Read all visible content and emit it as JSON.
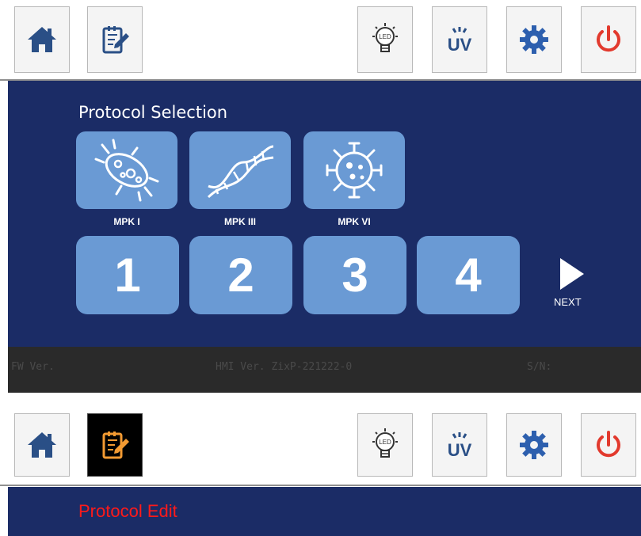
{
  "toolbar": {
    "icons": [
      "home-icon",
      "edit-icon",
      "led-icon",
      "uv-icon",
      "gear-icon",
      "power-icon"
    ],
    "led_label": "LED",
    "uv_label": "UV"
  },
  "screen1": {
    "title": "Protocol Selection",
    "protocols": [
      {
        "label": "MPK I",
        "icon": "bacteria-icon"
      },
      {
        "label": "MPK III",
        "icon": "dna-icon"
      },
      {
        "label": "MPK VI",
        "icon": "virus-icon"
      }
    ],
    "numbers": [
      "1",
      "2",
      "3",
      "4"
    ],
    "next_label": "NEXT",
    "status": {
      "fw": "FW Ver.",
      "hmi": "HMI  Ver. ZixP-221222-0",
      "sn": "S/N:"
    }
  },
  "screen2": {
    "title": "Protocol Edit",
    "active_tab": "edit"
  },
  "colors": {
    "background": "#1b2c66",
    "tile": "#6a9ad4",
    "home_icon": "#2a4f86",
    "gear_icon": "#2d5fae",
    "power_icon": "#e23a2e",
    "edit_active_title": "#ff1a1a"
  }
}
